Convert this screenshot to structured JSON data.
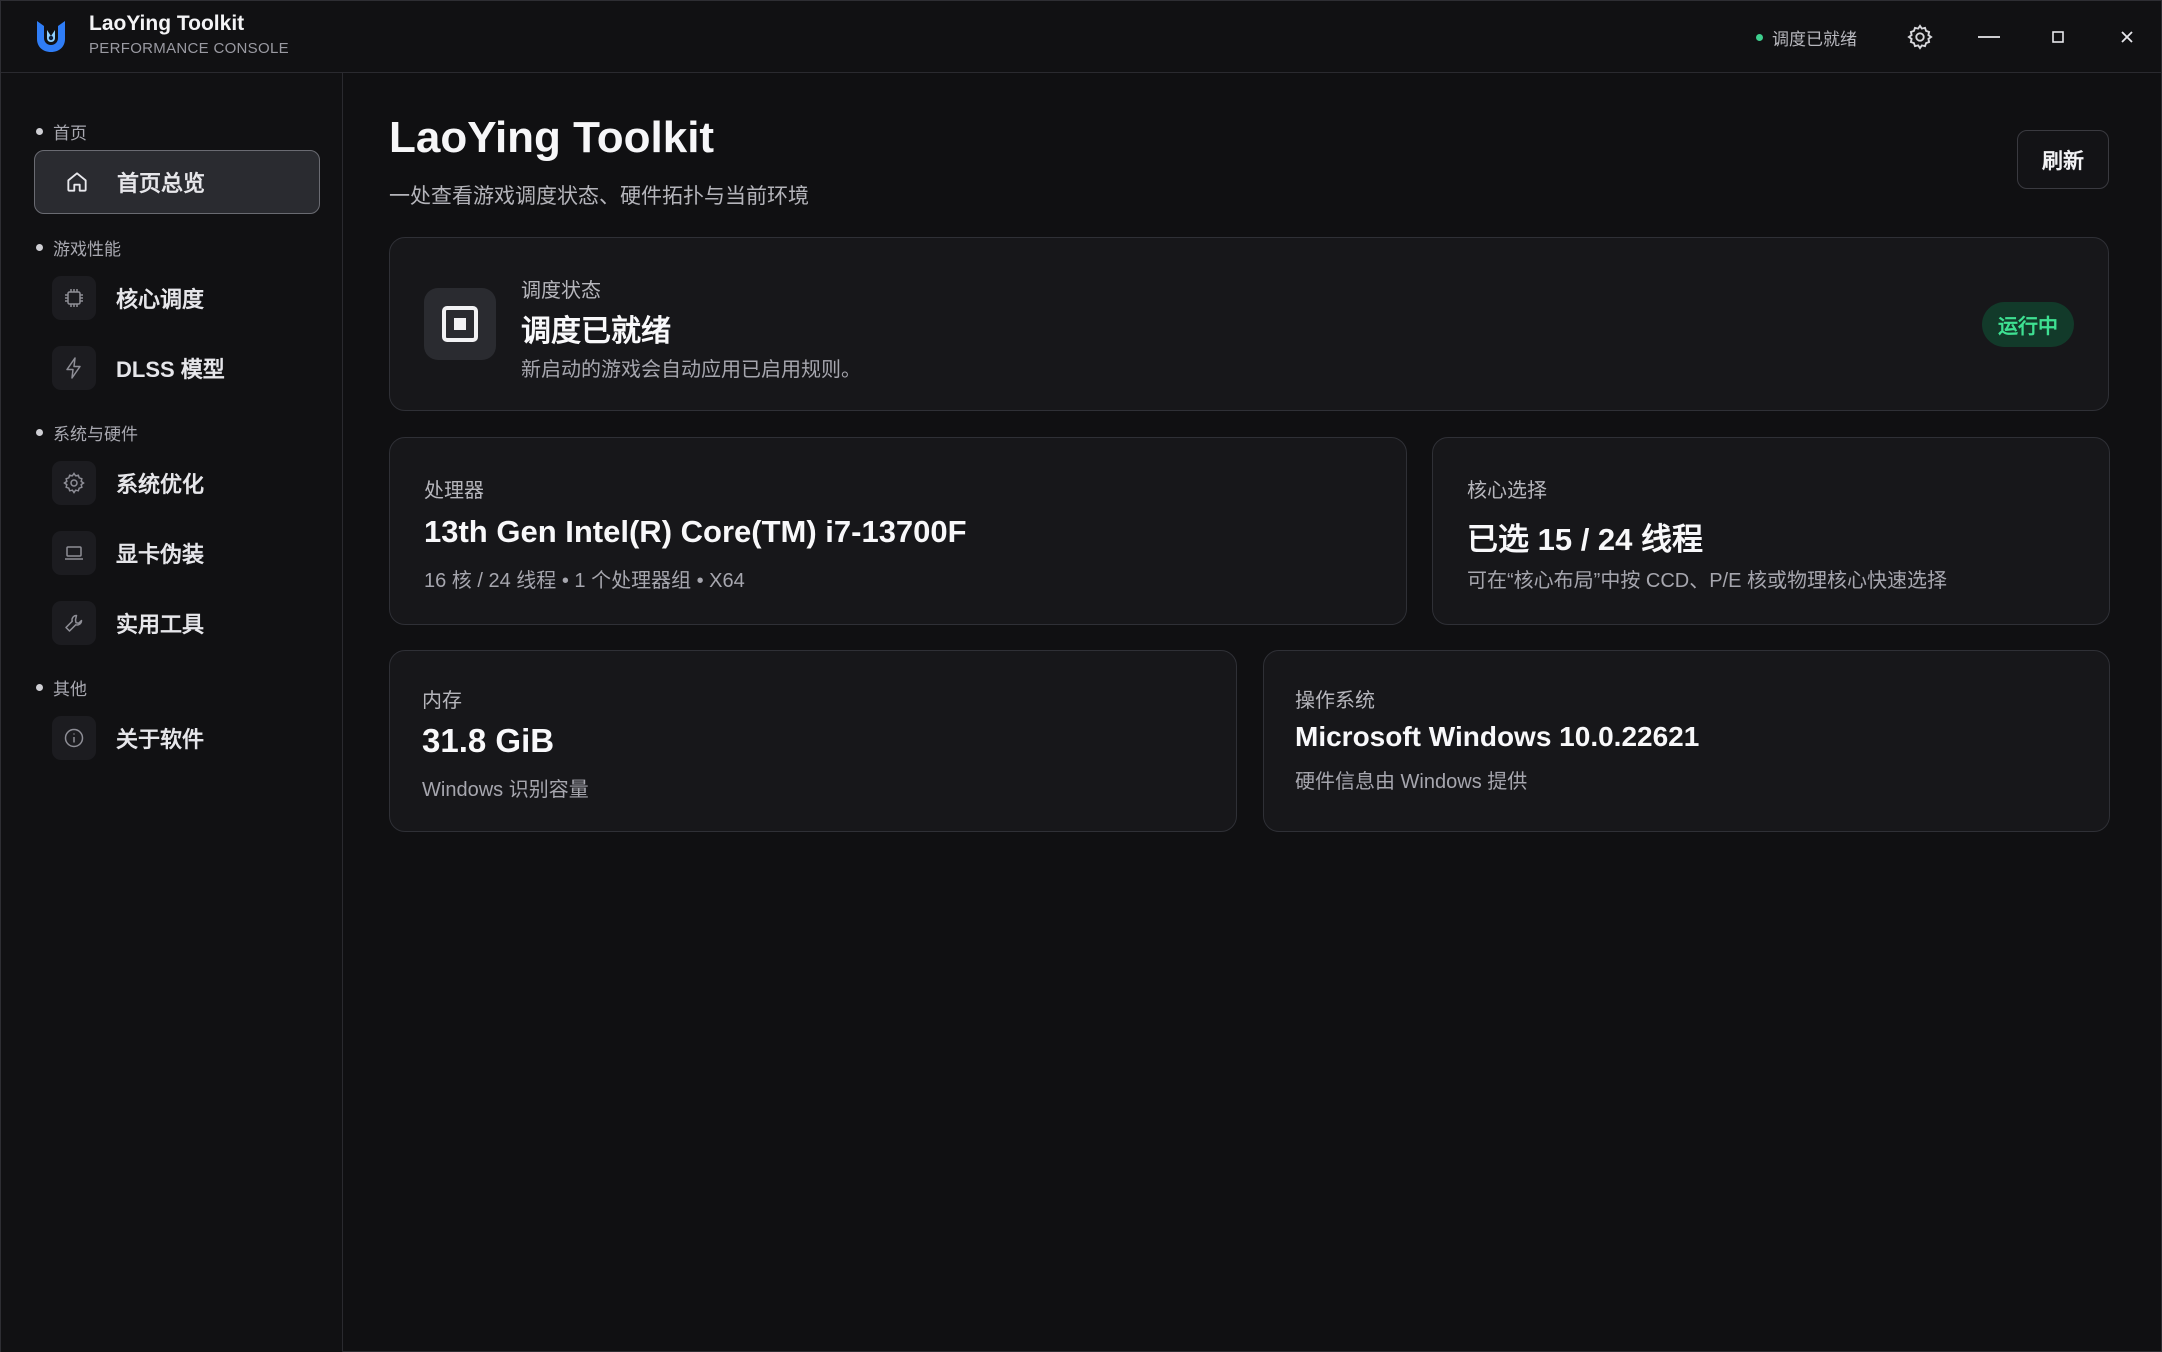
{
  "titlebar": {
    "app_name": "LaoYing Toolkit",
    "app_subtitle": "PERFORMANCE CONSOLE",
    "status_text": "调度已就绪",
    "status_color": "#3ecf8e",
    "icons": [
      "logo-icon",
      "settings-icon",
      "minimize-icon",
      "maximize-icon",
      "close-icon"
    ]
  },
  "sidebar": {
    "groups": [
      {
        "label": "首页",
        "items": [
          {
            "label": "首页总览",
            "icon": "home-icon",
            "active": true
          }
        ]
      },
      {
        "label": "游戏性能",
        "items": [
          {
            "label": "核心调度",
            "icon": "cpu-chip-icon"
          },
          {
            "label": "DLSS 模型",
            "icon": "lightning-icon"
          }
        ]
      },
      {
        "label": "系统与硬件",
        "items": [
          {
            "label": "系统优化",
            "icon": "gear-icon"
          },
          {
            "label": "显卡伪装",
            "icon": "laptop-icon"
          },
          {
            "label": "实用工具",
            "icon": "wrench-icon"
          }
        ]
      },
      {
        "label": "其他",
        "items": [
          {
            "label": "关于软件",
            "icon": "info-icon"
          }
        ]
      }
    ]
  },
  "main": {
    "title": "LaoYing Toolkit",
    "subtitle": "一处查看游戏调度状态、硬件拓扑与当前环境",
    "refresh_label": "刷新",
    "status_card": {
      "label": "调度状态",
      "value": "调度已就绪",
      "desc": "新启动的游戏会自动应用已启用规则。",
      "badge": "运行中",
      "badge_color": "#3ee092"
    },
    "cpu_card": {
      "label": "处理器",
      "value": "13th Gen Intel(R) Core(TM) i7-13700F",
      "desc": "16 核 / 24 线程 • 1 个处理器组 • X64"
    },
    "core_card": {
      "label": "核心选择",
      "value": "已选 15 / 24 线程",
      "desc": "可在“核心布局”中按 CCD、P/E 核或物理核心快速选择"
    },
    "memory_card": {
      "label": "内存",
      "value": "31.8 GiB",
      "desc": "Windows 识别容量"
    },
    "os_card": {
      "label": "操作系统",
      "value": "Microsoft Windows 10.0.22621",
      "desc": "硬件信息由 Windows 提供"
    }
  }
}
